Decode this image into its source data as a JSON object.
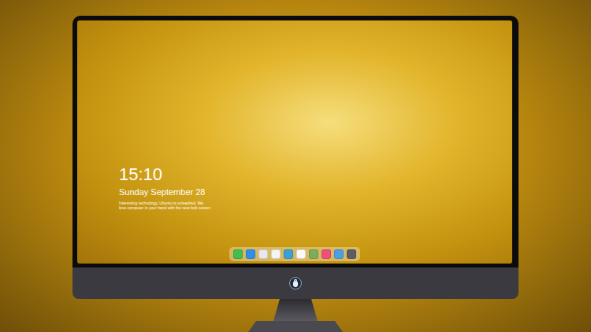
{
  "lock_screen": {
    "time": "15:10",
    "date": "Sunday September 28",
    "caption_lines": [
      "Interesting technology. Ubuntu is unleashed. We",
      "love computer in your hand with the new lock screen"
    ]
  },
  "dock": {
    "items": [
      {
        "color": "#3fbf4f"
      },
      {
        "color": "#2f8fe8"
      },
      {
        "color": "#e8e8ea"
      },
      {
        "color": "#f4f4f4"
      },
      {
        "color": "#3aa0d8"
      },
      {
        "color": "#fafafa"
      },
      {
        "color": "#7cae5a"
      },
      {
        "color": "#ef4f7a"
      },
      {
        "color": "#4a9fe8"
      },
      {
        "color": "#5c5c66"
      }
    ]
  }
}
